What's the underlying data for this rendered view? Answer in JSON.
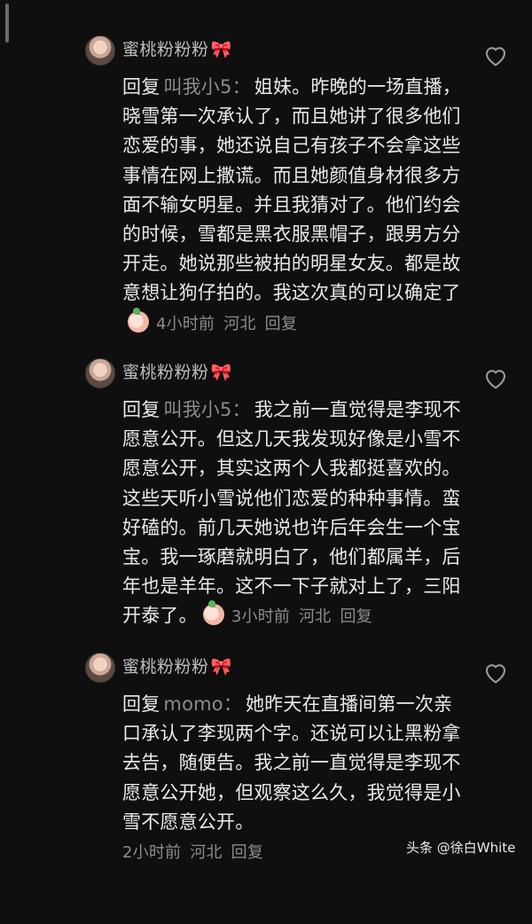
{
  "comments": [
    {
      "username": "蜜桃粉粉粉",
      "bow": "🎀",
      "reply_prefix": "回复",
      "reply_to": "叫我小5：",
      "text": "姐妹。昨晚的一场直播，晓雪第一次承认了，而且她讲了很多他们恋爱的事，她还说自己有孩子不会拿这些事情在网上撒谎。而且她颜值身材很多方面不输女明星。并且我猜对了。他们约会的时候，雪都是黑衣服黑帽子，跟男方分开走。她说那些被拍的明星女友。都是故意想让狗仔拍的。我这次真的可以确定了",
      "has_sticker": true,
      "time": "4小时前",
      "location": "河北",
      "reply_label": "回复",
      "heart_icon": "heart-outline-icon"
    },
    {
      "username": "蜜桃粉粉粉",
      "bow": "🎀",
      "reply_prefix": "回复",
      "reply_to": "叫我小5：",
      "text": "我之前一直觉得是李现不愿意公开。但这几天我发现好像是小雪不愿意公开，其实这两个人我都挺喜欢的。这些天听小雪说他们恋爱的种种事情。蛮好磕的。前几天她说也许后年会生一个宝宝。我一琢磨就明白了，他们都属羊，后年也是羊年。这不一下子就对上了，三阳开泰了。",
      "has_sticker": true,
      "time": "3小时前",
      "location": "河北",
      "reply_label": "回复",
      "heart_icon": "heart-outline-icon"
    },
    {
      "username": "蜜桃粉粉粉",
      "bow": "🎀",
      "reply_prefix": "回复",
      "reply_to": "momo：",
      "text": "她昨天在直播间第一次亲口承认了李现两个字。还说可以让黑粉拿去告，随便告。我之前一直觉得是李现不愿意公开她，但观察这么久，我觉得是小雪不愿意公开。",
      "has_sticker": false,
      "time": "2小时前",
      "location": "河北",
      "reply_label": "回复",
      "heart_icon": "heart-outline-icon"
    }
  ],
  "watermark": "头条 @徐白White",
  "colors": {
    "background": "#0f0f0f",
    "text": "#eaeaea",
    "muted": "#8c8c8c",
    "bow": "#ff3b5c"
  }
}
